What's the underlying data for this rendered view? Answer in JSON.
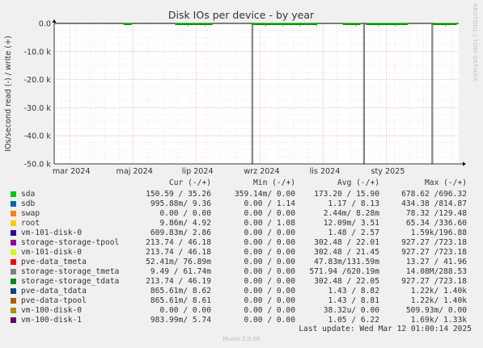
{
  "chart_data": {
    "type": "line",
    "title": "Disk IOs per device - by year",
    "ylabel": "IOs/second read (-) / write (+)",
    "ylim": [
      -50.0,
      0.0
    ],
    "yticks": [
      {
        "value": 0,
        "label": "0.0"
      },
      {
        "value": -10,
        "label": "-10.0 k"
      },
      {
        "value": -20,
        "label": "-20.0 k"
      },
      {
        "value": -30,
        "label": "-30.0 k"
      },
      {
        "value": -40,
        "label": "-40.0 k"
      },
      {
        "value": -50,
        "label": "-50.0 k"
      }
    ],
    "xrange": [
      "2024-02-15",
      "2025-03-12"
    ],
    "xticks": [
      {
        "date": "2024-03-01",
        "label": "mar 2024"
      },
      {
        "date": "2024-05-01",
        "label": "maj 2024"
      },
      {
        "date": "2024-07-01",
        "label": "lip 2024"
      },
      {
        "date": "2024-09-01",
        "label": "wrz 2024"
      },
      {
        "date": "2024-11-01",
        "label": "lis 2024"
      },
      {
        "date": "2025-01-01",
        "label": "sty 2025"
      }
    ],
    "grid": true,
    "series": [
      {
        "name": "sda",
        "color": "#00cc00"
      },
      {
        "name": "sdb",
        "color": "#0066b3"
      },
      {
        "name": "swap",
        "color": "#ff8000"
      },
      {
        "name": "root",
        "color": "#ffcc00"
      },
      {
        "name": "vm-101-disk-0",
        "color": "#330099"
      },
      {
        "name": "storage-storage-tpool",
        "color": "#990099"
      },
      {
        "name": "vm-101-disk-0",
        "color": "#ccff00"
      },
      {
        "name": "pve-data_tmeta",
        "color": "#ff0000"
      },
      {
        "name": "storage-storage_tmeta",
        "color": "#808080"
      },
      {
        "name": "storage-storage_tdata",
        "color": "#008f00"
      },
      {
        "name": "pve-data_tdata",
        "color": "#00487d"
      },
      {
        "name": "pve-data-tpool",
        "color": "#b35a00"
      },
      {
        "name": "vm-100-disk-0",
        "color": "#b38f00"
      },
      {
        "name": "vm-100-disk-1",
        "color": "#6b006b"
      }
    ],
    "read_spikes": [
      {
        "date": "2024-08-24",
        "value": -50.0
      },
      {
        "date": "2024-12-10",
        "value": -50.0
      },
      {
        "date": "2025-02-14",
        "value": -50.0
      }
    ],
    "activity_ranges": [
      {
        "from": "2024-04-22",
        "to": "2024-04-30"
      },
      {
        "from": "2024-06-11",
        "to": "2024-07-17"
      },
      {
        "from": "2024-08-25",
        "to": "2024-10-26"
      },
      {
        "from": "2024-11-20",
        "to": "2024-12-07"
      },
      {
        "from": "2024-12-12",
        "to": "2025-01-22"
      },
      {
        "from": "2025-02-15",
        "to": "2025-03-10"
      }
    ]
  },
  "legend": {
    "headers": {
      "cur": "Cur (-/+)",
      "min": "Min (-/+)",
      "avg": "Avg (-/+)",
      "max": "Max (-/+)"
    },
    "rows": [
      {
        "name": "sda",
        "cur": "150.59 / 35.26",
        "min": "359.14m/ 0.00",
        "avg": "173.20 / 15.90",
        "max": "678.62 /696.32"
      },
      {
        "name": "sdb",
        "cur": "995.88m/ 9.36",
        "min": "0.00 / 1.14",
        "avg": "1.17 / 8.13",
        "max": "434.38 /814.87"
      },
      {
        "name": "swap",
        "cur": "0.00 / 0.00",
        "min": "0.00 / 0.00",
        "avg": "2.44m/ 8.28m",
        "max": "78.32 /129.48"
      },
      {
        "name": "root",
        "cur": "9.86m/ 4.92",
        "min": "0.00 / 1.08",
        "avg": "12.09m/ 3.51",
        "max": "65.34 /336.60"
      },
      {
        "name": "vm-101-disk-0",
        "cur": "609.83m/ 2.86",
        "min": "0.00 / 0.00",
        "avg": "1.48 / 2.57",
        "max": "1.59k/196.88"
      },
      {
        "name": "storage-storage-tpool",
        "cur": "213.74 / 46.18",
        "min": "0.00 / 0.00",
        "avg": "302.48 / 22.01",
        "max": "927.27 /723.18"
      },
      {
        "name": "vm-101-disk-0",
        "cur": "213.74 / 46.18",
        "min": "0.00 / 0.00",
        "avg": "302.48 / 21.45",
        "max": "927.27 /723.18"
      },
      {
        "name": "pve-data_tmeta",
        "cur": "52.41m/ 76.89m",
        "min": "0.00 / 0.00",
        "avg": "47.83m/131.59m",
        "max": "13.27 / 41.96"
      },
      {
        "name": "storage-storage_tmeta",
        "cur": "9.49 / 61.74m",
        "min": "0.00 / 0.00",
        "avg": "571.94 /620.19m",
        "max": "14.08M/288.53"
      },
      {
        "name": "storage-storage_tdata",
        "cur": "213.74 / 46.19",
        "min": "0.00 / 0.00",
        "avg": "302.48 / 22.05",
        "max": "927.27 /723.18"
      },
      {
        "name": "pve-data_tdata",
        "cur": "865.61m/ 8.62",
        "min": "0.00 / 0.00",
        "avg": "1.43 / 8.82",
        "max": "1.22k/ 1.40k"
      },
      {
        "name": "pve-data-tpool",
        "cur": "865.61m/ 8.61",
        "min": "0.00 / 0.00",
        "avg": "1.43 / 8.81",
        "max": "1.22k/ 1.40k"
      },
      {
        "name": "vm-100-disk-0",
        "cur": "0.00 / 0.00",
        "min": "0.00 / 0.00",
        "avg": "38.32u/ 0.00",
        "max": "509.93m/ 0.00"
      },
      {
        "name": "vm-100-disk-1",
        "cur": "983.99m/ 5.74",
        "min": "0.00 / 0.00",
        "avg": "1.05 / 6.22",
        "max": "1.69k/ 1.33k"
      }
    ]
  },
  "last_update": "Last update: Wed Mar 12 01:00:14 2025",
  "footer": "Munin 2.0.56",
  "side_label": "RRDTOOL / TOBI OETIKER"
}
